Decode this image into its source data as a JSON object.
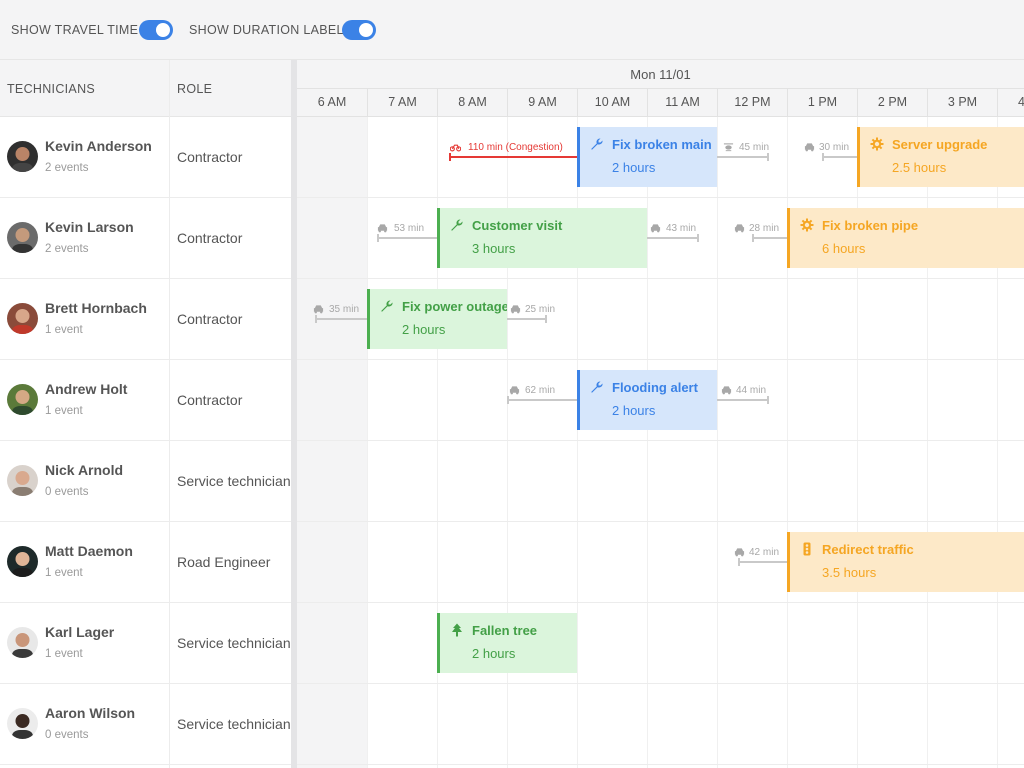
{
  "toolbar": {
    "show_travel_time_label": "SHOW TRAVEL TIME",
    "show_duration_label": "SHOW DURATION LABEL"
  },
  "columns": {
    "technicians": "TECHNICIANS",
    "role": "ROLE"
  },
  "schedule": {
    "date": "Mon 11/01",
    "hours": [
      "6 AM",
      "7 AM",
      "8 AM",
      "9 AM",
      "10 AM",
      "11 AM",
      "12 PM",
      "1 PM",
      "2 PM",
      "3 PM",
      "4"
    ]
  },
  "technicians": [
    {
      "name": "Kevin Anderson",
      "events": "2 events",
      "role": "Contractor"
    },
    {
      "name": "Kevin Larson",
      "events": "2 events",
      "role": "Contractor"
    },
    {
      "name": "Brett Hornbach",
      "events": "1 event",
      "role": "Contractor"
    },
    {
      "name": "Andrew Holt",
      "events": "1 event",
      "role": "Contractor"
    },
    {
      "name": "Nick Arnold",
      "events": "0 events",
      "role": "Service technician"
    },
    {
      "name": "Matt Daemon",
      "events": "1 event",
      "role": "Road Engineer"
    },
    {
      "name": "Karl Lager",
      "events": "1 event",
      "role": "Service technician"
    },
    {
      "name": "Aaron Wilson",
      "events": "0 events",
      "role": "Service technician"
    }
  ],
  "events": [
    {
      "name": "Fix broken main",
      "duration": "2 hours",
      "color": "#3b82e6",
      "icon": "wrench-icon"
    },
    {
      "name": "Server upgrade",
      "duration": "2.5 hours",
      "color": "#f5a623",
      "icon": "gear-icon"
    },
    {
      "name": "Customer visit",
      "duration": "3 hours",
      "color": "#4caf50",
      "icon": "wrench-icon"
    },
    {
      "name": "Fix broken pipe",
      "duration": "6 hours",
      "color": "#f5a623",
      "icon": "gear-icon"
    },
    {
      "name": "Fix power outage",
      "duration": "2 hours",
      "color": "#4caf50",
      "icon": "wrench-icon"
    },
    {
      "name": "Flooding alert",
      "duration": "2 hours",
      "color": "#3b82e6",
      "icon": "wrench-icon"
    },
    {
      "name": "Redirect traffic",
      "duration": "3.5 hours",
      "color": "#f5a623",
      "icon": "traffic-light-icon"
    },
    {
      "name": "Fallen tree",
      "duration": "2 hours",
      "color": "#4caf50",
      "icon": "tree-icon"
    }
  ],
  "travel": [
    {
      "label": "110 min (Congestion)",
      "icon": "motorbike-icon",
      "color": "#e53935"
    },
    {
      "label": "45 min",
      "icon": "helicopter-icon"
    },
    {
      "label": "30 min",
      "icon": "car-icon"
    },
    {
      "label": "53 min",
      "icon": "car-icon"
    },
    {
      "label": "43 min",
      "icon": "car-icon"
    },
    {
      "label": "28 min",
      "icon": "car-icon"
    },
    {
      "label": "35 min",
      "icon": "car-icon"
    },
    {
      "label": "25 min",
      "icon": "car-icon"
    },
    {
      "label": "62 min",
      "icon": "car-icon"
    },
    {
      "label": "44 min",
      "icon": "car-icon"
    },
    {
      "label": "42 min",
      "icon": "car-icon"
    }
  ]
}
